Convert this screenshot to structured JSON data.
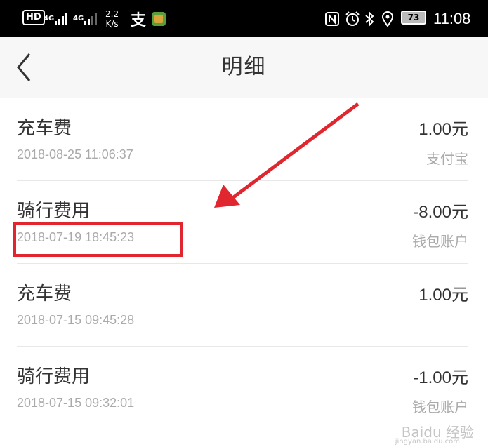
{
  "status_bar": {
    "badge": "HD",
    "signal1": "4G",
    "signal2": "4G",
    "speed_value": "2.2",
    "speed_unit": "K/s",
    "alipay_glyph": "支",
    "battery": "73",
    "time": "11:08",
    "icons": [
      "nfc-icon",
      "alarm-icon",
      "bluetooth-icon",
      "location-icon"
    ]
  },
  "header": {
    "title": "明细",
    "back_icon": "chevron-left-icon"
  },
  "transactions": [
    {
      "title": "充车费",
      "date": "2018-08-25 11:06:37",
      "amount": "1.00元",
      "source": "支付宝"
    },
    {
      "title": "骑行费用",
      "date": "2018-07-19 18:45:23",
      "amount": "-8.00元",
      "source": "钱包账户"
    },
    {
      "title": "充车费",
      "date": "2018-07-15 09:45:28",
      "amount": "1.00元",
      "source": ""
    },
    {
      "title": "骑行费用",
      "date": "2018-07-15 09:32:01",
      "amount": "-1.00元",
      "source": "钱包账户"
    }
  ],
  "watermark": {
    "main": "Baidu 经验",
    "sub": "jingyan.baidu.com"
  },
  "colors": {
    "annotation_red": "#e0262e",
    "header_bg": "#f7f7f7",
    "secondary_text": "#aaaaaa"
  }
}
